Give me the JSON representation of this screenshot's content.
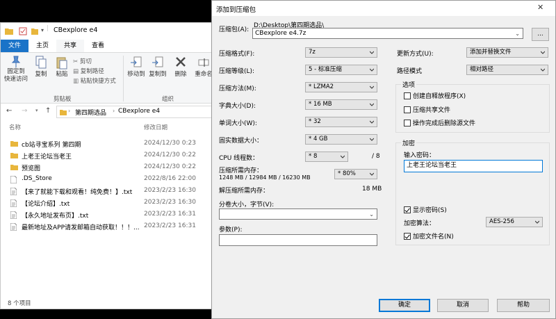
{
  "explorer": {
    "title": "CBexplore e4",
    "tabs": [
      "文件",
      "主页",
      "共享",
      "查看"
    ],
    "ribbon": {
      "pin_label": "固定到\n快速访问",
      "copy_label": "复制",
      "paste_label": "粘贴",
      "cut_label": "剪切",
      "copy_path_label": "复制路径",
      "paste_shortcut_label": "粘贴快捷方式",
      "move_to_label": "移动到",
      "copy_to_label": "复制到",
      "delete_label": "删除",
      "rename_label": "重命名",
      "clipboard_group": "剪贴板",
      "organize_group": "组织"
    },
    "breadcrumb": [
      "第四期选品",
      "CBexplore e4"
    ],
    "columns": {
      "name": "名称",
      "date": "修改日期"
    },
    "files": [
      {
        "name": "cb站寻宝系列 第四期",
        "date": "2024/12/30 0:23",
        "type": "folder"
      },
      {
        "name": "上老王论坛当老王",
        "date": "2024/12/30 0:22",
        "type": "folder"
      },
      {
        "name": "预览图",
        "date": "2024/12/30 0:22",
        "type": "folder"
      },
      {
        "name": ".DS_Store",
        "date": "2022/8/16 22:00",
        "type": "file"
      },
      {
        "name": "【来了就能下载和观看！纯免费！】.txt",
        "date": "2023/2/23 16:30",
        "type": "txt"
      },
      {
        "name": "【论坛介绍】.txt",
        "date": "2023/2/23 16:30",
        "type": "txt"
      },
      {
        "name": "【永久地址发布页】.txt",
        "date": "2023/2/23 16:31",
        "type": "txt"
      },
      {
        "name": "最新地址及APP请发邮箱自动获取！！！...",
        "date": "2023/2/23 16:31",
        "type": "txt"
      }
    ],
    "status": "8 个项目"
  },
  "dialog": {
    "title": "添加到压缩包",
    "archive_label": "压缩包(A):",
    "archive_path": "D:\\Desktop\\第四期选品\\",
    "archive_name": "CBexplore e4.7z",
    "browse_label": "...",
    "format_label": "压缩格式(F):",
    "format_value": "7z",
    "level_label": "压缩等级(L):",
    "level_value": "5 - 标准压缩",
    "method_label": "压缩方法(M):",
    "method_value": "* LZMA2",
    "dict_label": "字典大小(D):",
    "dict_value": "* 16 MB",
    "word_label": "单词大小(W):",
    "word_value": "* 32",
    "solid_label": "固实数据大小：",
    "solid_value": "* 4 GB",
    "cpu_label": "CPU 线程数：",
    "cpu_value": "* 8",
    "cpu_total": "/ 8",
    "mem_comp_label": "压缩所需内存：",
    "mem_comp_value": "1248 MB / 12984 MB / 16230 MB",
    "mem_percent": "* 80%",
    "mem_decomp_label": "解压缩所需内存：",
    "mem_decomp_value": "18 MB",
    "split_label": "分卷大小，字节(V):",
    "params_label": "参数(P):",
    "update_label": "更新方式(U):",
    "update_value": "添加并替换文件",
    "path_label": "路径模式",
    "path_value": "相对路径",
    "options_title": "选项",
    "opt_sfx": "创建自释放程序(X)",
    "opt_shared": "压缩共享文件",
    "opt_delete": "操作完成后删除源文件",
    "encrypt_title": "加密",
    "password_label": "输入密码：",
    "password_value": "上老王论坛当老王",
    "show_password": "显示密码(S)",
    "enc_method_label": "加密算法：",
    "enc_method_value": "AES-256",
    "encrypt_names": "加密文件名(N)",
    "ok_label": "确定",
    "cancel_label": "取消",
    "help_label": "帮助"
  },
  "colors": {
    "accent": "#1a73c8",
    "folder": "#e8b63c",
    "focus": "#0078d7"
  }
}
